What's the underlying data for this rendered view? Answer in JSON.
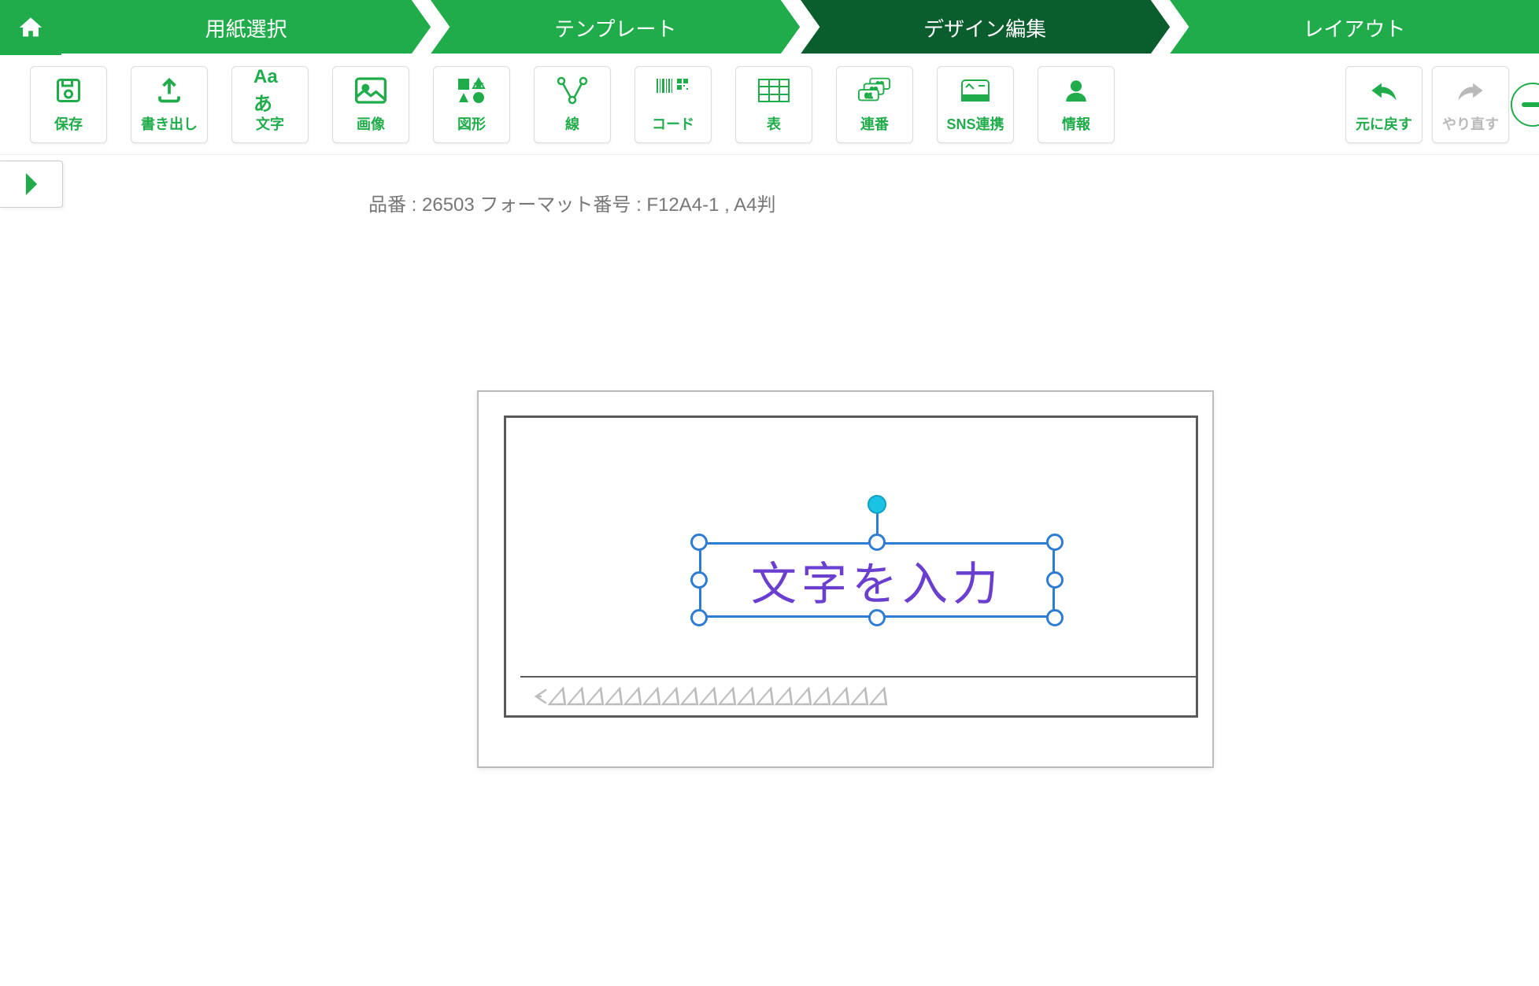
{
  "stepper": {
    "steps": [
      {
        "label": "用紙選択"
      },
      {
        "label": "テンプレート"
      },
      {
        "label": "デザイン編集"
      },
      {
        "label": "レイアウト"
      }
    ],
    "active_index": 2
  },
  "toolbar": {
    "save": "保存",
    "export": "書き出し",
    "text": "文字",
    "image": "画像",
    "shape": "図形",
    "line": "線",
    "code": "コード",
    "table": "表",
    "serial": "連番",
    "sns": "SNS連携",
    "info": "情報",
    "undo": "元に戻す",
    "redo": "やり直す",
    "text_icon_label": "Aaあ"
  },
  "info_bar": "品番 : 26503 フォーマット番号 : F12A4-1 , A4判",
  "canvas": {
    "text_object": "文字を入力"
  }
}
